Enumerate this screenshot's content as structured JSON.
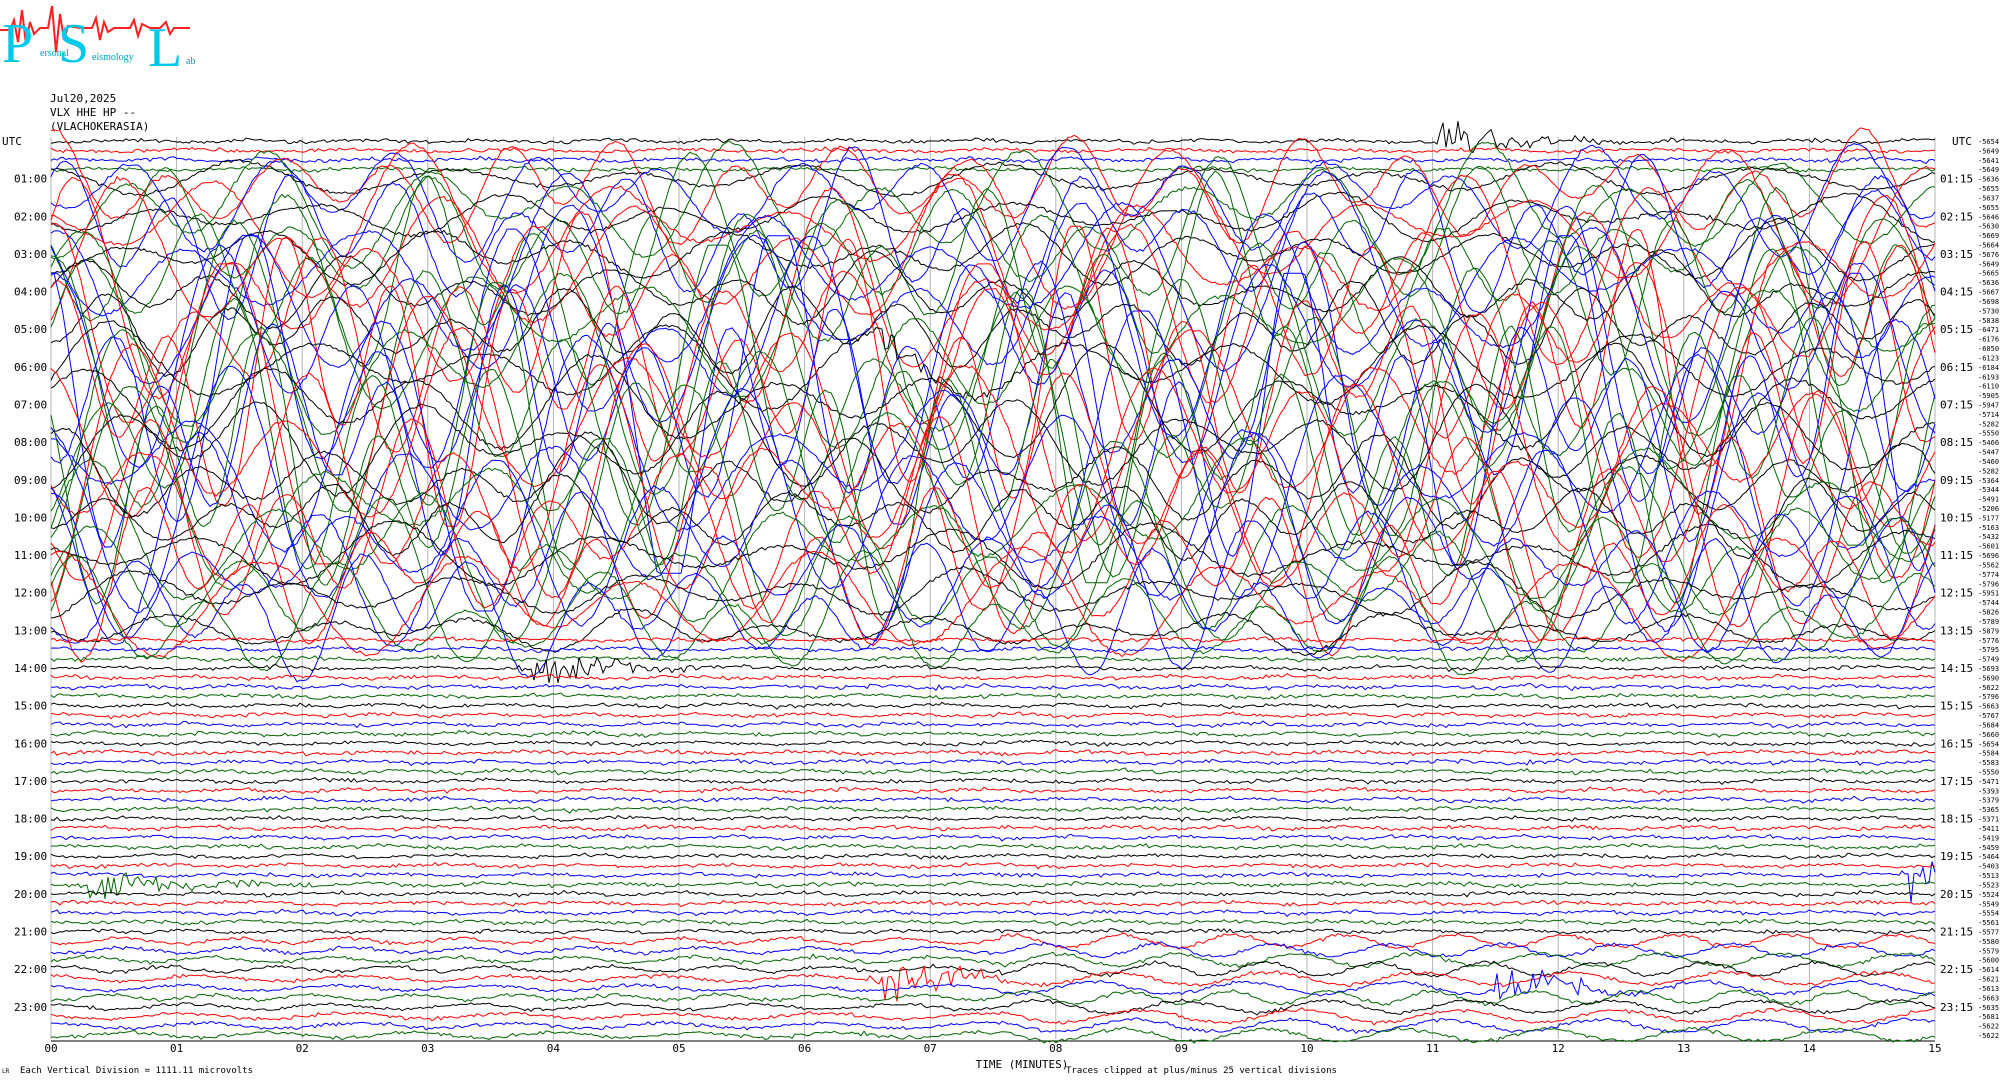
{
  "logo": {
    "letters": [
      "P",
      "S",
      "L"
    ],
    "words": [
      "ersonal",
      "eismology",
      "ab"
    ],
    "colors": {
      "letters": "#00c8e8",
      "signal": "#ff2020"
    }
  },
  "header": {
    "date": "Jul20,2025",
    "station": "VLX HHE HP --",
    "location": "(VLACHOKERASIA)"
  },
  "chart_data": {
    "type": "line",
    "description_units": {
      "x": "minutes",
      "rows": "UTC hour/quarter"
    },
    "left_axis_title": "UTC",
    "right_axis_title": "UTC",
    "left_hour_labels": [
      "01:00",
      "02:00",
      "03:00",
      "04:00",
      "05:00",
      "06:00",
      "07:00",
      "08:00",
      "09:00",
      "10:00",
      "11:00",
      "12:00",
      "13:00",
      "14:00",
      "15:00",
      "16:00",
      "17:00",
      "18:00",
      "19:00",
      "20:00",
      "21:00",
      "22:00",
      "23:00"
    ],
    "right_hour_labels": [
      "01:15",
      "02:15",
      "03:15",
      "04:15",
      "05:15",
      "06:15",
      "07:15",
      "08:15",
      "09:15",
      "10:15",
      "11:15",
      "12:15",
      "13:15",
      "14:15",
      "15:15",
      "16:15",
      "17:15",
      "18:15",
      "19:15",
      "20:15",
      "21:15",
      "22:15",
      "23:15"
    ],
    "x_ticks": [
      "00",
      "01",
      "02",
      "03",
      "04",
      "05",
      "06",
      "07",
      "08",
      "09",
      "10",
      "11",
      "12",
      "13",
      "14",
      "15"
    ],
    "xlim": [
      0,
      15
    ],
    "xlabel": "TIME (MINUTES)",
    "trace_count": 96,
    "trace_colors": [
      "#000000",
      "#ff0000",
      "#0000ff",
      "#006400"
    ],
    "row_offsets": [
      -5654,
      -5649,
      -5641,
      -5649,
      -5636,
      -5655,
      -5637,
      -5655,
      -5646,
      -5630,
      -5669,
      -5664,
      -5676,
      -5649,
      -5665,
      -5636,
      -5667,
      -5698,
      -5730,
      -5838,
      -6471,
      -6176,
      -6050,
      -6123,
      -6184,
      -6193,
      -6110,
      -5905,
      -5947,
      -5714,
      -5282,
      -5550,
      -5466,
      -5447,
      -5460,
      -5282,
      -5364,
      -5344,
      -5491,
      -5206,
      -5177,
      -5163,
      -5432,
      -5601,
      -5696,
      -5562,
      -5774,
      -5796,
      -5951,
      -5744,
      -5826,
      -5789,
      -5879,
      -5776,
      -5795,
      -5749,
      -5693,
      -5690,
      -5622,
      -5796,
      -5663,
      -5767,
      -5684,
      -5660,
      -5654,
      -5584,
      -5583,
      -5550,
      -5471,
      -5393,
      -5379,
      -5365,
      -5371,
      -5411,
      -5419,
      -5459,
      -5464,
      -5403,
      -5513,
      -5523,
      -5524,
      -5549,
      -5554,
      -5561,
      -5577,
      -5580,
      -5579,
      -5600,
      -5614,
      -5621,
      -5613,
      -5663,
      -5635,
      -5681,
      -5622,
      -5622
    ],
    "active_band_hours": [
      1,
      13
    ],
    "events": [
      {
        "trace": 0,
        "minute": 11.0
      },
      {
        "trace": 24,
        "minute": 6.5
      },
      {
        "trace": 56,
        "minute": 3.8
      },
      {
        "trace": 79,
        "minute": 0.3
      },
      {
        "trace": 78,
        "minute": 14.8
      },
      {
        "trace": 89,
        "minute": 6.6
      },
      {
        "trace": 90,
        "minute": 11.5
      }
    ]
  },
  "footer": {
    "scale_note": "Each Vertical Division = 1111.11 microvolts",
    "clip_note": "Traces clipped at plus/minus 25 vertical divisions",
    "corner_mark": "LR"
  }
}
